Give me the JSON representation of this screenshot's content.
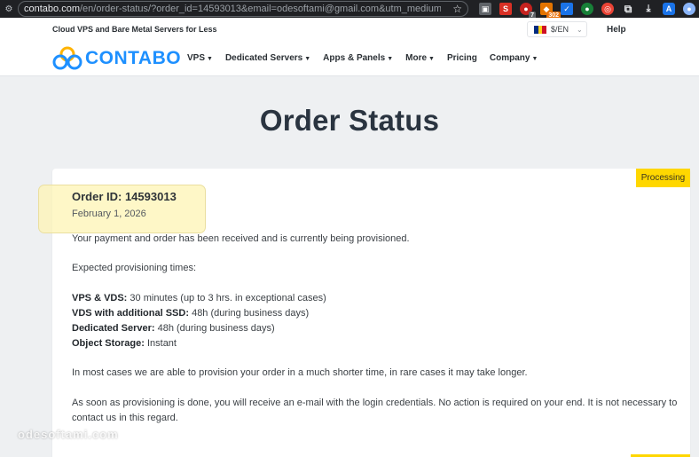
{
  "browser": {
    "url_host": "contabo.com",
    "url_rest": "/en/order-status/?order_id=14593013&email=odesoftami@gmail.com&utm_medium=..."
  },
  "topbar": {
    "tagline": "Cloud VPS and Bare Metal Servers for Less",
    "language": "$/EN",
    "help": "Help",
    "flag_colors": [
      "#002b7f",
      "#fcd116",
      "#ce1126"
    ]
  },
  "nav": {
    "logo_text": "CONTABO",
    "brand_color": "#1e90ff",
    "items": [
      {
        "label": "VPS",
        "has_caret": true
      },
      {
        "label": "Dedicated Servers",
        "has_caret": true
      },
      {
        "label": "Apps & Panels",
        "has_caret": true
      },
      {
        "label": "More",
        "has_caret": true
      },
      {
        "label": "Pricing",
        "has_caret": false
      },
      {
        "label": "Company",
        "has_caret": true
      }
    ]
  },
  "page": {
    "title": "Order Status"
  },
  "order": {
    "status": "Processing",
    "status_color": "#ffd700",
    "id_label": "Order ID: 14593013",
    "date": "February 1, 2026",
    "received_text": "Your payment and order has been received and is currently being provisioned.",
    "expected_heading": "Expected provisioning times:",
    "times": [
      {
        "label": "VPS & VDS:",
        "value": " 30 minutes (up to 3 hrs. in exceptional cases)"
      },
      {
        "label": "VDS with additional SSD:",
        "value": " 48h (during business days)"
      },
      {
        "label": "Dedicated Server:",
        "value": " 48h (during business days)"
      },
      {
        "label": "Object Storage:",
        "value": " Instant"
      }
    ],
    "shorter_text": "In most cases we are able to provision your order in a much shorter time, in rare cases it may take longer.",
    "email_text": "As soon as provisioning is done, you will receive an e-mail with the login credentials. No action is required on your end. It is not necessary to contact us in this regard."
  },
  "watermark": "odesoftami.com"
}
